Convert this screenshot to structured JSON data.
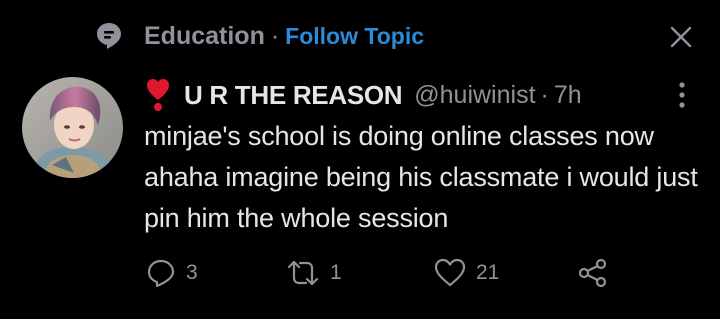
{
  "topic": {
    "name": "Education",
    "separator": "·",
    "follow_label": "Follow Topic"
  },
  "tweet": {
    "name_emoji": "❣️",
    "display_name": "U R THE REASON",
    "handle": "@huiwinist",
    "separator": "·",
    "time": "7h",
    "text": "minjae's school is doing online classes now ahaha imagine being his classmate i would just pin him the whole session"
  },
  "actions": {
    "replies": "3",
    "retweets": "1",
    "likes": "21"
  },
  "colors": {
    "background": "#000000",
    "text_primary": "#e6e6e6",
    "text_secondary": "#8f9399",
    "link": "#2d8ad6",
    "heart_emoji": "#e0182d"
  },
  "icons": {
    "topic": "topic-speech-bubble-icon",
    "close": "close-icon",
    "more": "more-vertical-icon",
    "reply": "reply-icon",
    "retweet": "retweet-icon",
    "like": "like-heart-icon",
    "share": "share-icon"
  }
}
